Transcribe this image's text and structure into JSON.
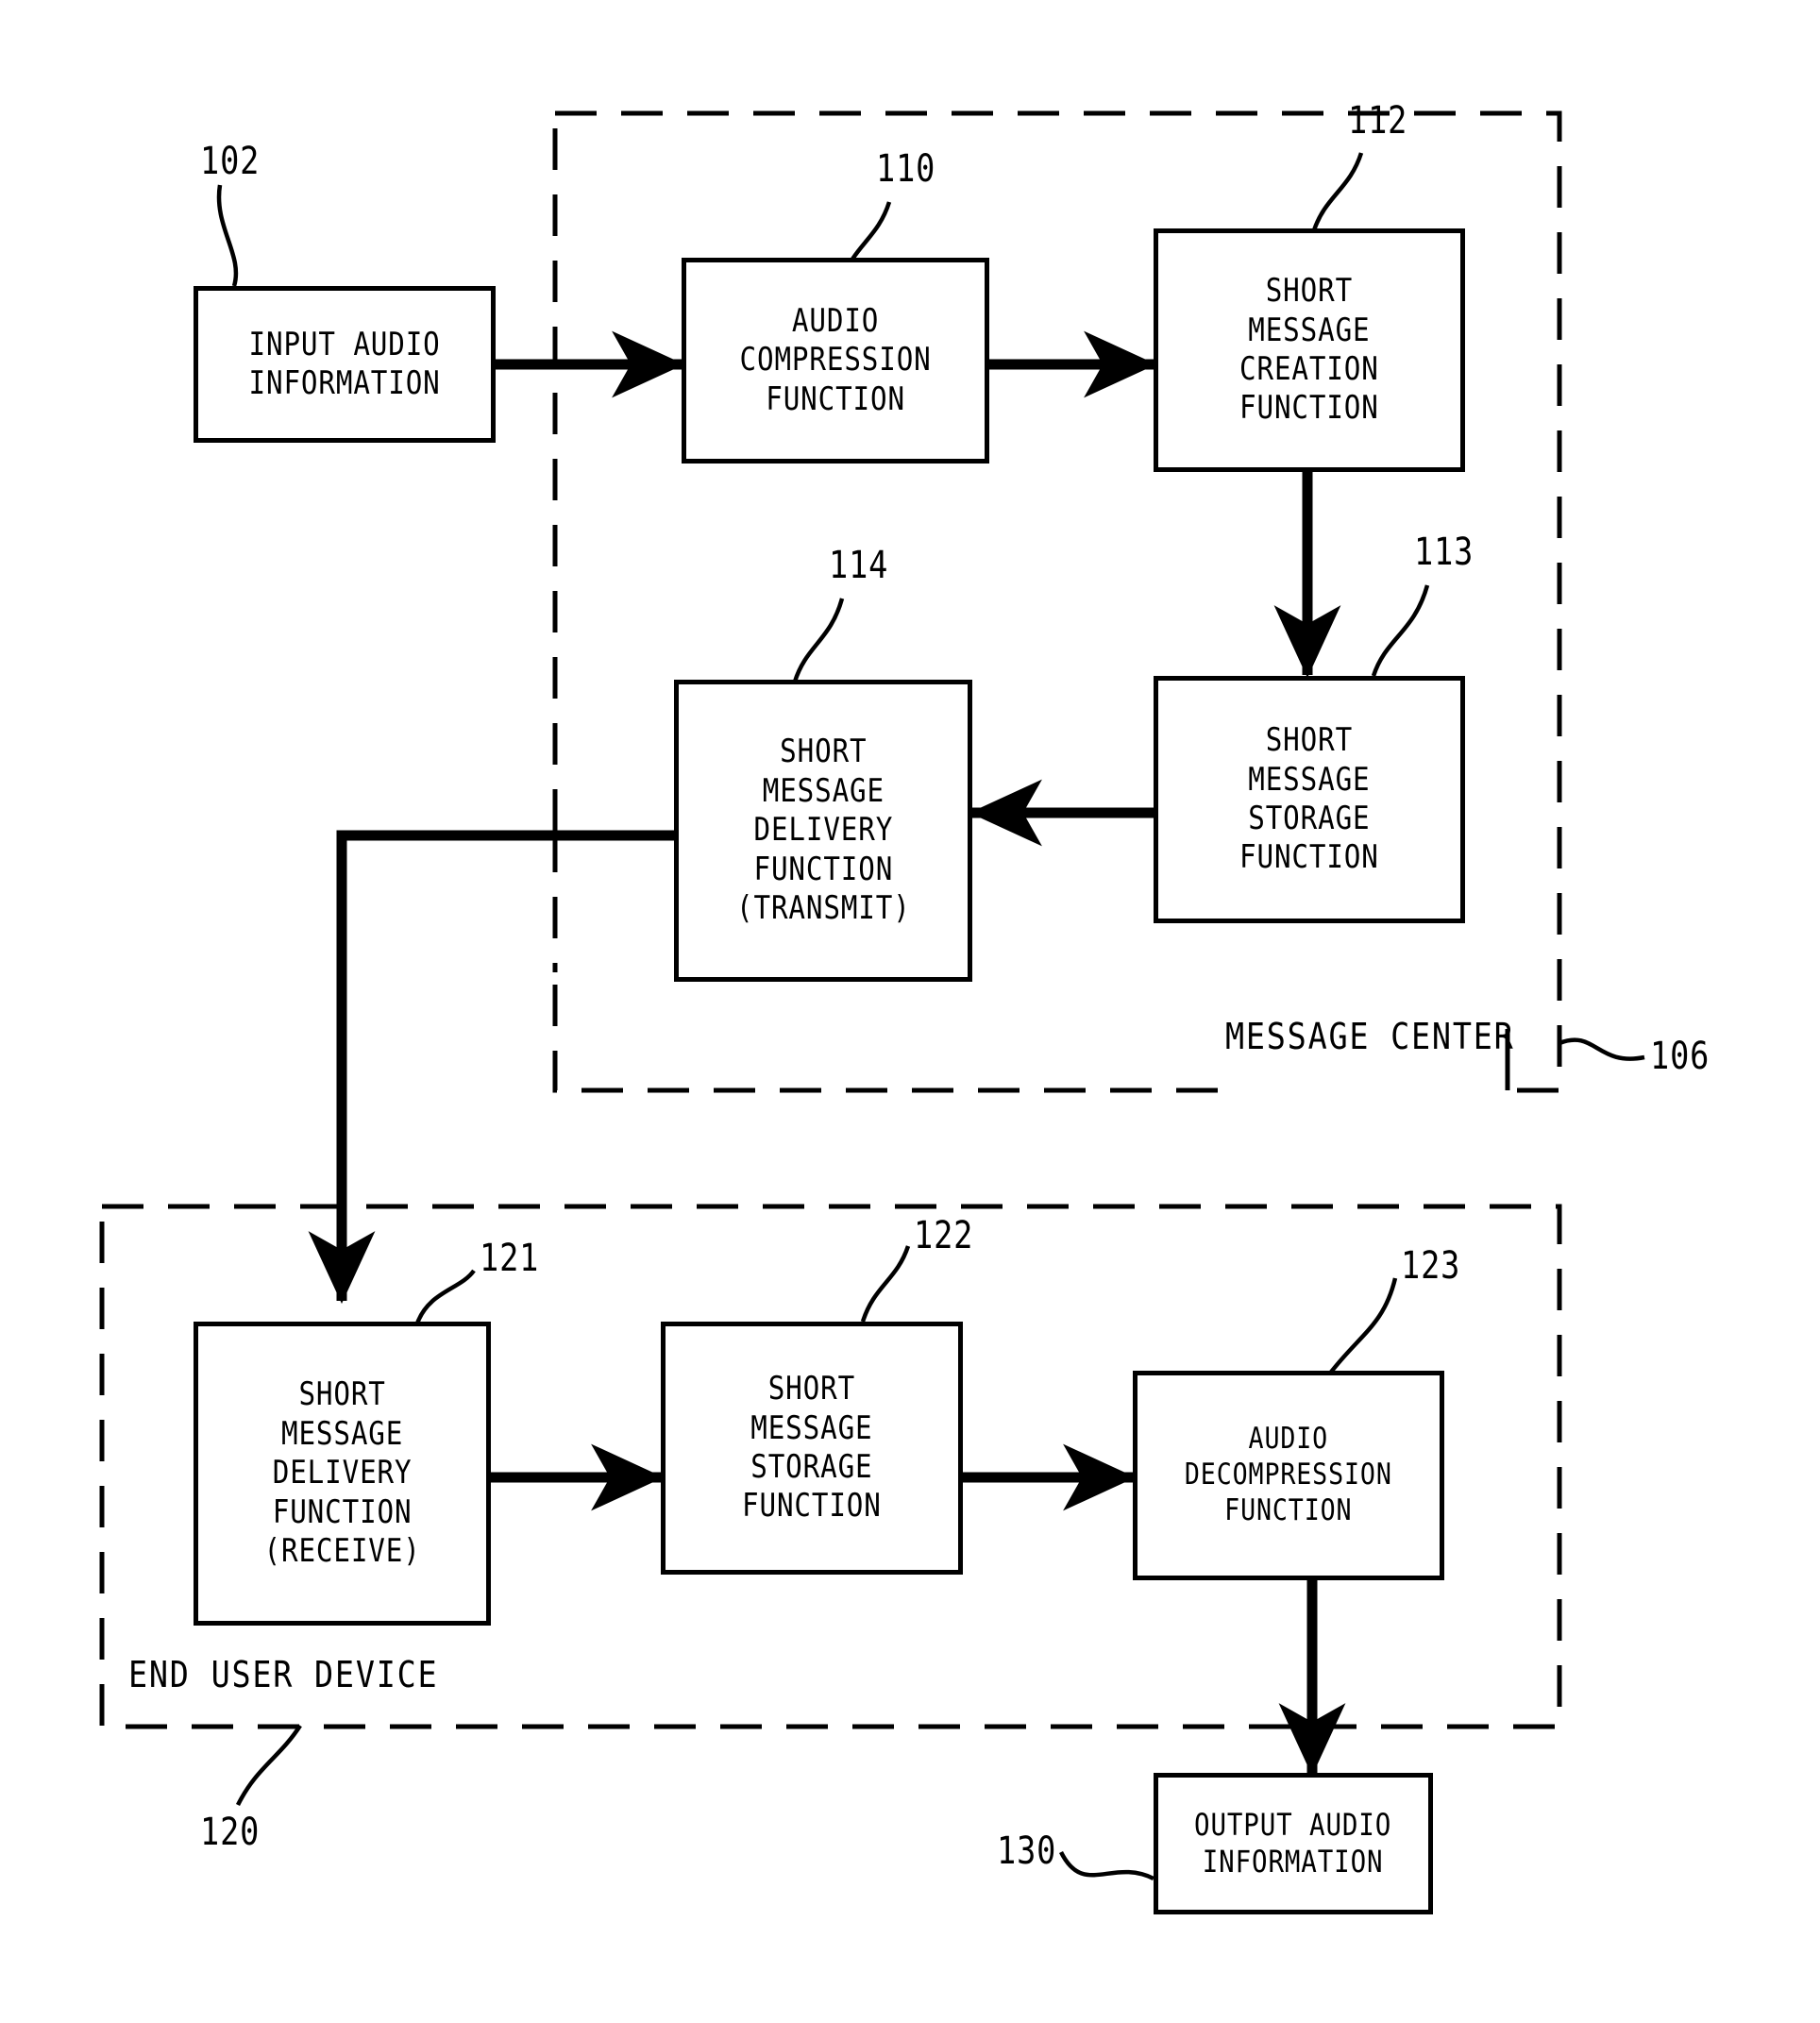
{
  "figure": {
    "title_visible": false,
    "ink_color": "#000000",
    "background_color": "#ffffff"
  },
  "groups": [
    {
      "id": "message-center",
      "label": "MESSAGE CENTER",
      "ref": "106"
    },
    {
      "id": "end-user-device",
      "label": "END USER DEVICE",
      "ref": "120"
    }
  ],
  "nodes": [
    {
      "id": "input-audio-information",
      "label": "INPUT AUDIO\nINFORMATION",
      "ref": "102"
    },
    {
      "id": "audio-compression-function",
      "label": "AUDIO\nCOMPRESSION\nFUNCTION",
      "ref": "110"
    },
    {
      "id": "short-message-creation-function",
      "label": "SHORT\nMESSAGE\nCREATION\nFUNCTION",
      "ref": "112"
    },
    {
      "id": "short-message-storage-function-mc",
      "label": "SHORT\nMESSAGE\nSTORAGE\nFUNCTION",
      "ref": "113"
    },
    {
      "id": "short-message-delivery-function-transmit",
      "label": "SHORT\nMESSAGE\nDELIVERY\nFUNCTION\n(TRANSMIT)",
      "ref": "114"
    },
    {
      "id": "short-message-delivery-function-receive",
      "label": "SHORT\nMESSAGE\nDELIVERY\nFUNCTION\n(RECEIVE)",
      "ref": "121"
    },
    {
      "id": "short-message-storage-function-eud",
      "label": "SHORT\nMESSAGE\nSTORAGE\nFUNCTION",
      "ref": "122"
    },
    {
      "id": "audio-decompression-function",
      "label": "AUDIO\nDECOMPRESSION\nFUNCTION",
      "ref": "123"
    },
    {
      "id": "output-audio-information",
      "label": "OUTPUT AUDIO\nINFORMATION",
      "ref": "130"
    }
  ],
  "refs": {
    "n102": "102",
    "n110": "110",
    "n112": "112",
    "n113": "113",
    "n114": "114",
    "n106": "106",
    "n120": "120",
    "n121": "121",
    "n122": "122",
    "n123": "123",
    "n130": "130"
  },
  "edges": [
    {
      "from": "input-audio-information",
      "to": "audio-compression-function",
      "style": "solid-arrow"
    },
    {
      "from": "audio-compression-function",
      "to": "short-message-creation-function",
      "style": "solid-arrow"
    },
    {
      "from": "short-message-creation-function",
      "to": "short-message-storage-function-mc",
      "style": "solid-arrow"
    },
    {
      "from": "short-message-storage-function-mc",
      "to": "short-message-delivery-function-transmit",
      "style": "solid-arrow"
    },
    {
      "from": "short-message-delivery-function-transmit",
      "to": "short-message-delivery-function-receive",
      "style": "solid-arrow"
    },
    {
      "from": "short-message-delivery-function-receive",
      "to": "short-message-storage-function-eud",
      "style": "solid-arrow"
    },
    {
      "from": "short-message-storage-function-eud",
      "to": "audio-decompression-function",
      "style": "solid-arrow"
    },
    {
      "from": "audio-decompression-function",
      "to": "output-audio-information",
      "style": "solid-arrow"
    }
  ]
}
